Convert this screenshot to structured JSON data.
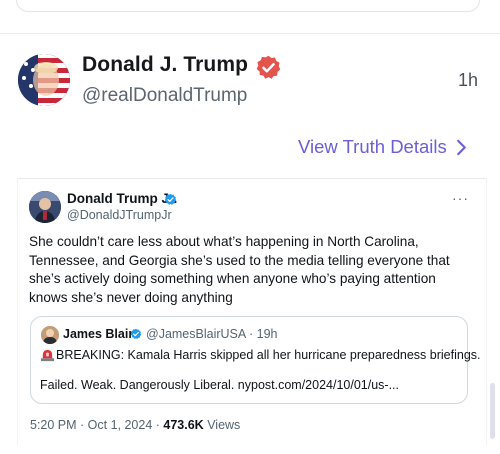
{
  "post": {
    "author_name": "Donald J. Trump",
    "author_handle": "@realDonaldTrump",
    "time": "1h",
    "details_link": "View Truth Details"
  },
  "embedded_tweet": {
    "name": "Donald Trump Jr.",
    "handle": "@DonaldJTrumpJr",
    "more": "···",
    "text_lines": [
      "She couldn’t care less about what’s happening in North Carolina,",
      "Tennessee, and Georgia she’s used to the media telling everyone that",
      "she’s actively doing something when anyone who’s paying attention",
      "knows she’s never doing anything"
    ],
    "quote": {
      "name": "James Blair",
      "handle_time": "@JamesBlairUSA · 19h",
      "line1": "BREAKING: Kamala Harris skipped all her hurricane preparedness briefings.",
      "line2": "Failed. Weak. Dangerously Liberal.  nypost.com/2024/10/01/us-..."
    },
    "meta_datetime": "5:20 PM · Oct 1, 2024 · ",
    "meta_views": "473.6K",
    "meta_views_label": " Views"
  },
  "icons": {
    "verified": "verified-badge-icon",
    "chevron": "chevron-right-icon",
    "siren": "siren-emoji-icon"
  },
  "colors": {
    "truth_verified": "#e2544c",
    "twitter_verified": "#1d9bf0",
    "link_purple": "#6b5fd3"
  }
}
